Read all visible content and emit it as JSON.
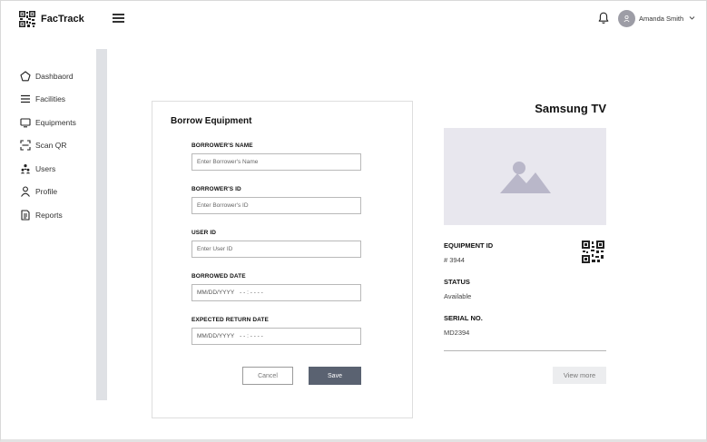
{
  "app": {
    "name": "FacTrack"
  },
  "header": {
    "user_name": "Amanda Smith"
  },
  "sidebar": {
    "items": [
      {
        "label": "Dashbaord",
        "icon": "pentagon-icon"
      },
      {
        "label": "Facilities",
        "icon": "list-icon"
      },
      {
        "label": "Equipments",
        "icon": "monitor-icon"
      },
      {
        "label": "Scan QR",
        "icon": "scan-icon"
      },
      {
        "label": "Users",
        "icon": "users-icon"
      },
      {
        "label": "Profile",
        "icon": "person-icon"
      },
      {
        "label": "Reports",
        "icon": "document-icon"
      }
    ]
  },
  "form": {
    "title": "Borrow Equipment",
    "fields": [
      {
        "label": "BORROWER'S NAME",
        "placeholder": "Enter Borrower's Name"
      },
      {
        "label": "BORROWER'S ID",
        "placeholder": "Enter Borrower's ID"
      },
      {
        "label": "USER ID",
        "placeholder": "Enter User ID"
      },
      {
        "label": "BORROWED DATE",
        "date_placeholder": "MM/DD/YYYY",
        "time_placeholder": "- - : - - - -"
      },
      {
        "label": "EXPECTED RETURN DATE",
        "date_placeholder": "MM/DD/YYYY",
        "time_placeholder": "- - : - - - -"
      }
    ],
    "cancel_label": "Cancel",
    "save_label": "Save"
  },
  "equipment": {
    "name": "Samsung TV",
    "id_label": "EQUIPMENT ID",
    "id_value": "# 3944",
    "status_label": "STATUS",
    "status_value": "Available",
    "serial_label": "SERIAL NO.",
    "serial_value": "MD2394",
    "view_more_label": "View more"
  },
  "colors": {
    "save_button": "#5a6271",
    "image_placeholder_bg": "#e8e7ee",
    "image_placeholder_icon": "#b9b7c9",
    "scroll_track": "#dfe1e5",
    "avatar": "#9d9da6"
  }
}
